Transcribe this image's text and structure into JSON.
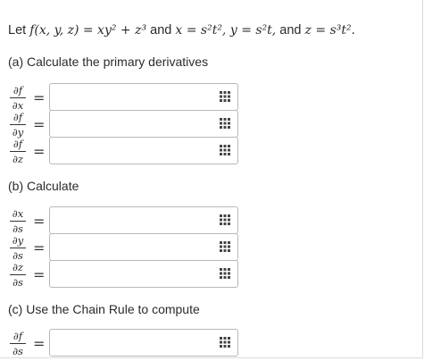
{
  "problem": {
    "lead": "Let",
    "func": "f(x, y, z) = xy² + z³",
    "and1": "and",
    "defs": "x = s²t², y = s²t,",
    "and2": "and",
    "zdef": "z = s³t²."
  },
  "part_a": {
    "heading": "(a) Calculate the primary derivatives",
    "rows": [
      {
        "num": "∂f",
        "den": "∂x",
        "eq": "=",
        "value": ""
      },
      {
        "num": "∂f",
        "den": "∂y",
        "eq": "=",
        "value": ""
      },
      {
        "num": "∂f",
        "den": "∂z",
        "eq": "=",
        "value": ""
      }
    ]
  },
  "part_b": {
    "heading": "(b) Calculate",
    "rows": [
      {
        "num": "∂x",
        "den": "∂s",
        "eq": "=",
        "value": ""
      },
      {
        "num": "∂y",
        "den": "∂s",
        "eq": "=",
        "value": ""
      },
      {
        "num": "∂z",
        "den": "∂s",
        "eq": "=",
        "value": ""
      }
    ]
  },
  "part_c": {
    "heading": "(c) Use the Chain Rule to compute",
    "rows": [
      {
        "num": "∂f",
        "den": "∂s",
        "eq": "=",
        "value": ""
      }
    ]
  },
  "icons": {
    "keypad": "keypad-icon"
  },
  "colors": {
    "border": "#b8b8b8",
    "text": "#2b2b2b",
    "icon": "#444444"
  }
}
